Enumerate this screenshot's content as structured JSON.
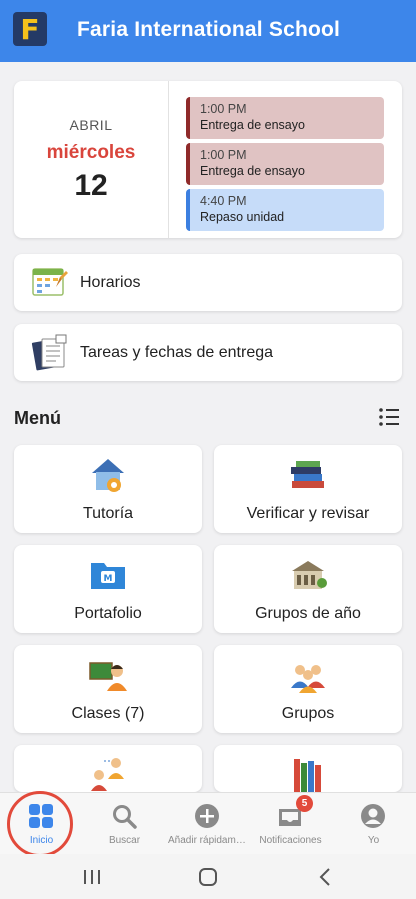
{
  "header": {
    "logo_letter": "F",
    "school_name": "Faria International School"
  },
  "calendar": {
    "month": "ABRIL",
    "weekday": "miércoles",
    "day": "12",
    "events": [
      {
        "time": "1:00 PM",
        "title": "Entrega de ensayo",
        "color": "#8f2a2a"
      },
      {
        "time": "1:00 PM",
        "title": "Entrega de ensayo",
        "color": "#8f2a2a"
      },
      {
        "time": "4:40 PM",
        "title": "Repaso unidad",
        "color": "#3c7fe0"
      }
    ]
  },
  "links": [
    {
      "label": "Horarios",
      "icon": "schedule-icon"
    },
    {
      "label": "Tareas y fechas de entrega",
      "icon": "assignments-icon"
    }
  ],
  "menu": {
    "title": "Menú",
    "tiles": [
      {
        "label": "Tutoría",
        "icon": "tutoring-house-icon"
      },
      {
        "label": "Verificar y revisar",
        "icon": "books-icon"
      },
      {
        "label": "Portafolio",
        "icon": "portfolio-folder-icon"
      },
      {
        "label": "Grupos de año",
        "icon": "school-building-icon"
      },
      {
        "label": "Clases (7)",
        "icon": "classes-icon"
      },
      {
        "label": "Grupos",
        "icon": "groups-icon"
      }
    ]
  },
  "bottom_nav": {
    "items": [
      {
        "label": "Inicio",
        "icon": "home-grid-icon",
        "active": true
      },
      {
        "label": "Buscar",
        "icon": "search-icon"
      },
      {
        "label": "Añadir rápidame...",
        "icon": "add-icon"
      },
      {
        "label": "Notificaciones",
        "icon": "inbox-icon",
        "badge": "5"
      },
      {
        "label": "Yo",
        "icon": "profile-icon"
      }
    ]
  },
  "colors": {
    "brand": "#3d86ea",
    "accent_red": "#e24a3b",
    "weekday": "#d9453c"
  }
}
